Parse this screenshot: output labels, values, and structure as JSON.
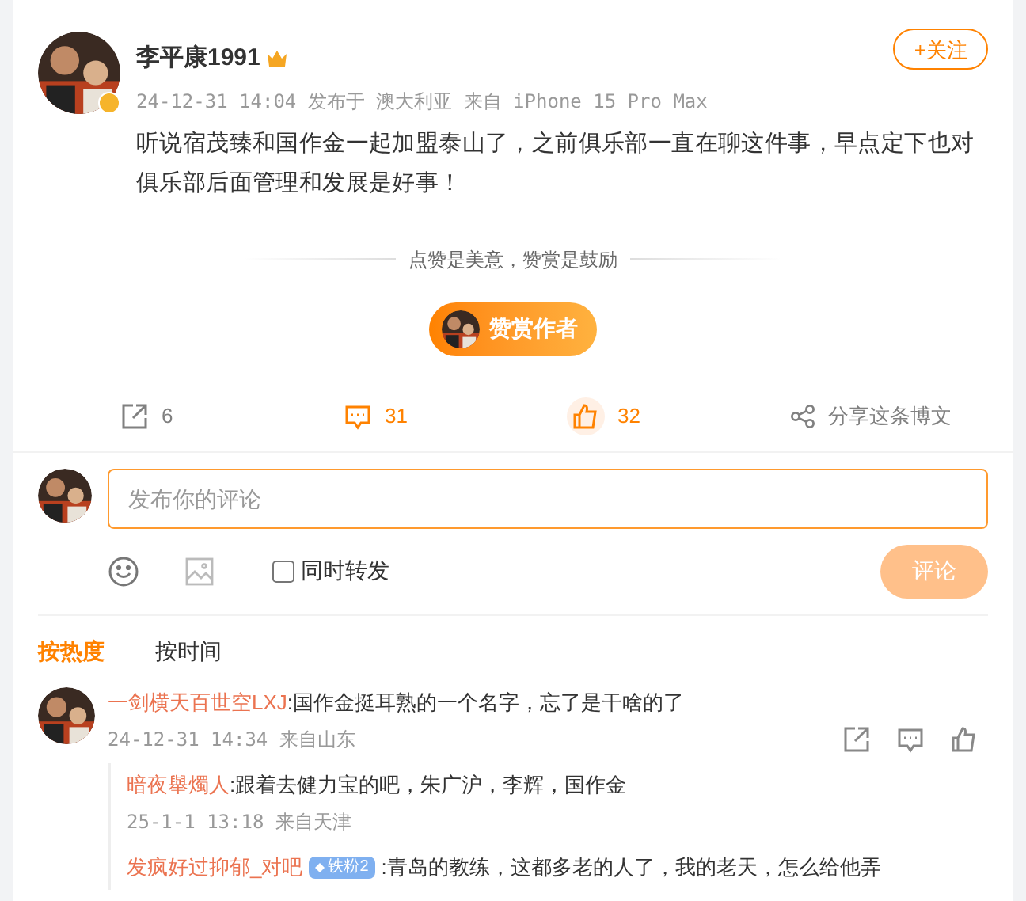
{
  "post": {
    "author": {
      "name": "李平康1991",
      "verified": true
    },
    "follow_button": "+关注",
    "meta": "24-12-31 14:04 发布于 澳大利亚 来自 iPhone 15 Pro Max",
    "text": "听说宿茂臻和国作金一起加盟泰山了，之前俱乐部一直在聊这件事，早点定下也对俱乐部后面管理和发展是好事！"
  },
  "reward": {
    "slogan": "点赞是美意，赞赏是鼓励",
    "button": "赞赏作者"
  },
  "actions": [
    {
      "kind": "repost",
      "count": "6",
      "selected": false
    },
    {
      "kind": "comment",
      "count": "31",
      "selected": true
    },
    {
      "kind": "like",
      "count": "32",
      "selected": true
    },
    {
      "kind": "share",
      "count": "分享这条博文",
      "selected": false
    }
  ],
  "composer": {
    "placeholder": "发布你的评论",
    "repost_label": "同时转发",
    "repost_checked": false,
    "submit": "评论"
  },
  "sort_tabs": [
    {
      "label": "按热度",
      "selected": true
    },
    {
      "label": "按时间",
      "selected": false
    }
  ],
  "comments": [
    {
      "name": "一剑横天百世空LXJ",
      "text": ":国作金挺耳熟的一个名字，忘了是干啥的了",
      "meta": "24-12-31 14:34 来自山东",
      "replies": [
        {
          "name": "暗夜舉燭人",
          "text": ":跟着去健力宝的吧，朱广沪，李辉，国作金",
          "meta": "25-1-1 13:18 来自天津"
        },
        {
          "name": "发疯好过抑郁_对吧",
          "badge": "铁粉2",
          "text": ":青岛的教练，这都多老的人了，我的老天，怎么给他弄"
        }
      ]
    }
  ]
}
